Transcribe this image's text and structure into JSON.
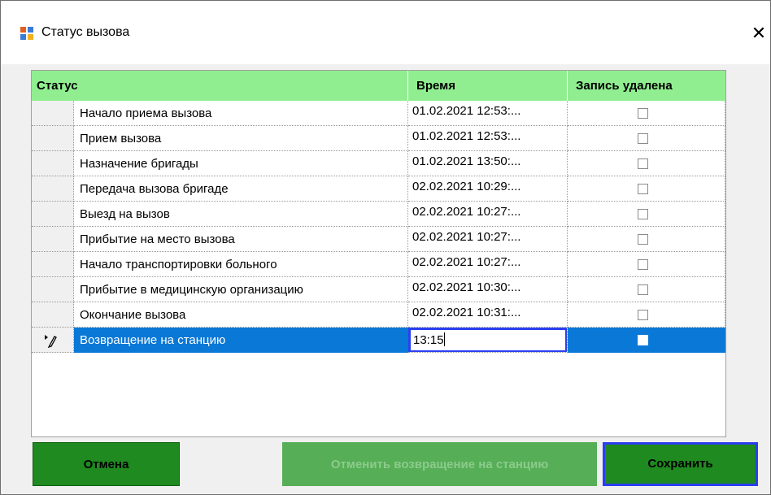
{
  "window": {
    "title": "Статус вызова",
    "close_glyph": "✕"
  },
  "table": {
    "headers": {
      "status": "Статус",
      "time": "Время",
      "deleted": "Запись удалена"
    },
    "rows": [
      {
        "status": "Начало приема вызова",
        "time": "01.02.2021 12:53:...",
        "deleted": false
      },
      {
        "status": "Прием вызова",
        "time": "01.02.2021 12:53:...",
        "deleted": false
      },
      {
        "status": "Назначение бригады",
        "time": "01.02.2021 13:50:...",
        "deleted": false
      },
      {
        "status": "Передача вызова бригаде",
        "time": "02.02.2021 10:29:...",
        "deleted": false
      },
      {
        "status": "Выезд на вызов",
        "time": "02.02.2021 10:27:...",
        "deleted": false
      },
      {
        "status": "Прибытие на место вызова",
        "time": "02.02.2021 10:27:...",
        "deleted": false
      },
      {
        "status": "Начало транспортировки больного",
        "time": "02.02.2021 10:27:...",
        "deleted": false
      },
      {
        "status": "Прибытие в медицинскую организацию",
        "time": "02.02.2021 10:30:...",
        "deleted": false
      },
      {
        "status": "Окончание вызова",
        "time": "02.02.2021 10:31:...",
        "deleted": false
      },
      {
        "status": "Возвращение на станцию",
        "time": "13:15",
        "deleted": false,
        "selected": true,
        "editing": true
      }
    ]
  },
  "buttons": {
    "cancel": "Отмена",
    "undo_return": "Отменить возвращение на станцию",
    "save": "Сохранить"
  },
  "colors": {
    "header_bg": "#90ee90",
    "selection": "#0a78d7",
    "button_green": "#1f8a1f",
    "focus_border": "#2b3ff0"
  },
  "icons": {
    "app": "form-app-icon",
    "row_edit": "pencil-edit-icon",
    "close": "close-icon"
  }
}
